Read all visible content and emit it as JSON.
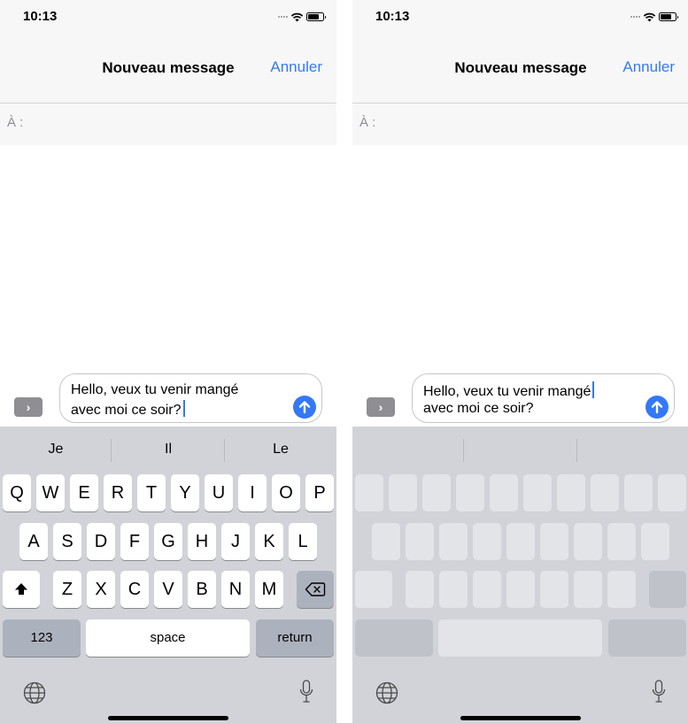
{
  "left": {
    "status": {
      "time": "10:13"
    },
    "nav": {
      "title": "Nouveau message",
      "cancel": "Annuler"
    },
    "to_label": "À :",
    "message": {
      "line1": "Hello, veux tu venir mangé",
      "line2": "avec moi ce soir?",
      "expand_glyph": "›"
    },
    "predictions": [
      "Je",
      "Il",
      "Le"
    ],
    "keys": {
      "row1": [
        "Q",
        "W",
        "E",
        "R",
        "T",
        "Y",
        "U",
        "I",
        "O",
        "P"
      ],
      "row2": [
        "A",
        "S",
        "D",
        "F",
        "G",
        "H",
        "J",
        "K",
        "L"
      ],
      "row3": [
        "Z",
        "X",
        "C",
        "V",
        "B",
        "N",
        "M"
      ],
      "numbers": "123",
      "space": "space",
      "return": "return"
    }
  },
  "right": {
    "status": {
      "time": "10:13"
    },
    "nav": {
      "title": "Nouveau message",
      "cancel": "Annuler"
    },
    "to_label": "À :",
    "message": {
      "line1": "Hello, veux tu venir mangé",
      "line2": "avec moi ce soir?",
      "expand_glyph": "›"
    }
  },
  "colors": {
    "accent": "#3478f6",
    "keyboard_bg": "#d1d3d9",
    "bar_bg": "#f7f7f7",
    "dark_key": "#acb2bd"
  },
  "icons": [
    "wifi-icon",
    "battery-icon",
    "signal-icon",
    "chevron-right-icon",
    "send-arrow-icon",
    "shift-icon",
    "backspace-icon",
    "globe-icon",
    "mic-icon"
  ]
}
